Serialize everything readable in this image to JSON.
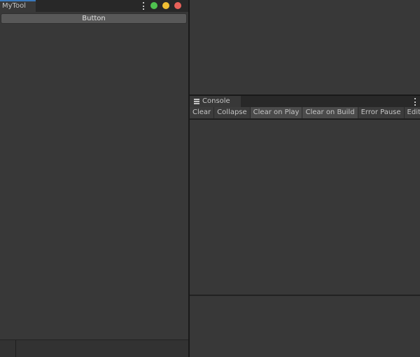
{
  "left_window": {
    "tab": "MyTool",
    "button": "Button",
    "traffic_lights": [
      "#4fc24f",
      "#f0be33",
      "#e8615a"
    ]
  },
  "console": {
    "tab": "Console",
    "icon": "console-list-icon",
    "toolbar": [
      {
        "label": "Clear",
        "active": false
      },
      {
        "label": "Collapse",
        "active": false
      },
      {
        "label": "Clear on Play",
        "active": true
      },
      {
        "label": "Clear on Build",
        "active": true
      },
      {
        "label": "Error Pause",
        "active": false
      },
      {
        "label": "Editor",
        "active": false,
        "dropdown": true
      }
    ]
  }
}
